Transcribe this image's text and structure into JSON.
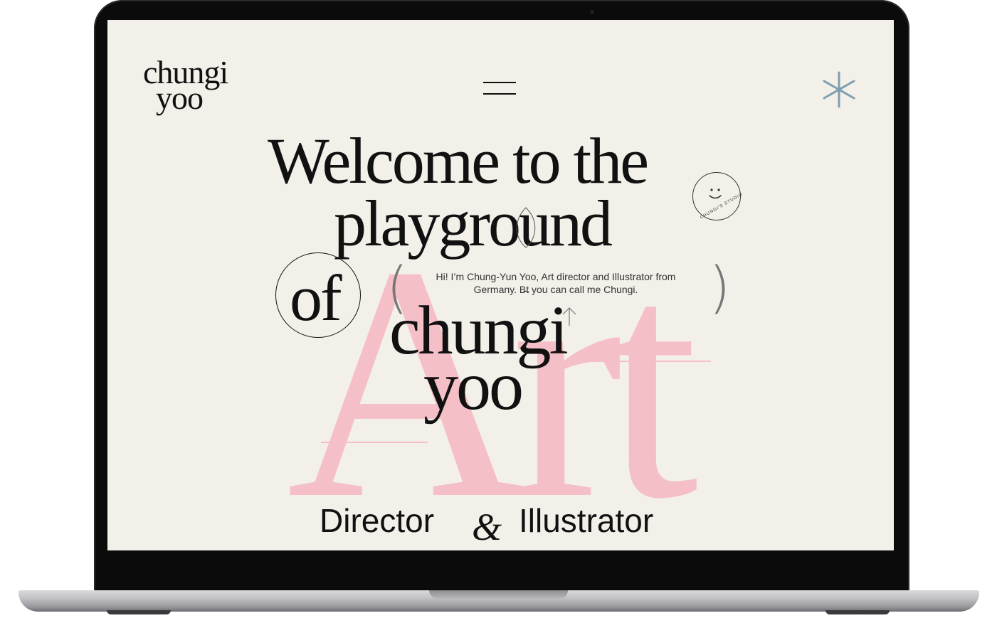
{
  "logo": {
    "line1": "chungi",
    "line2": "yoo"
  },
  "hero": {
    "line1": "Welcome to the",
    "line2": "playground",
    "line3": "of",
    "name_line1": "chungi",
    "name_line2": "yoo",
    "background_word": "Art",
    "intro": "Hi! I’m Chung-Yun Yoo, Art director and Illustrator from Germany. B̶t you can call me Chungi.",
    "paren_open": "(",
    "paren_close": ")",
    "role_left": "Director",
    "role_amp": "&",
    "role_right": "Illustrator"
  },
  "badge": {
    "text": "CHUNGI'S STUDIO"
  },
  "icons": {
    "menu": "hamburger-menu-icon",
    "star": "asterisk-icon",
    "badge": "smiley-icon"
  },
  "colors": {
    "background": "#f3efe9",
    "accent_pink": "#f5bfc8",
    "accent_blue": "#7f9fb0",
    "text": "#111111"
  }
}
